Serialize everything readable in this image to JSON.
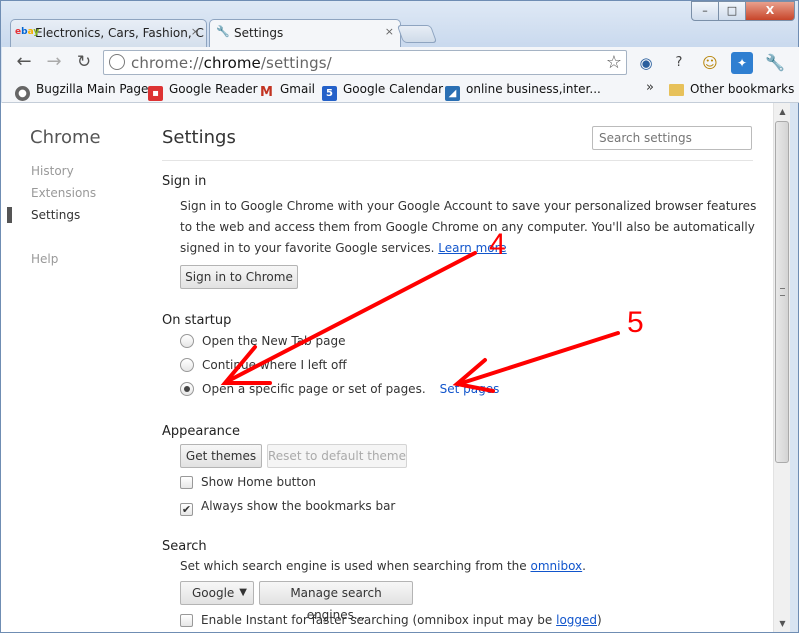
{
  "window": {
    "tabs": [
      {
        "label": "Electronics, Cars, Fashion, C",
        "icon": "ebay-icon",
        "close": "×"
      },
      {
        "label": "Settings",
        "icon": "wrench-icon",
        "close": "×"
      }
    ],
    "controls": {
      "minimize": "–",
      "maximize": "□",
      "close": "X"
    }
  },
  "toolbar": {
    "url_scheme": "chrome://",
    "url_host": "chrome",
    "url_path": "/settings/",
    "back_glyph": "←",
    "forward_glyph": "→",
    "reload_glyph": "C"
  },
  "bookmarks": {
    "items": [
      {
        "label": "Bugzilla Main Page",
        "icon": "bugzilla-icon"
      },
      {
        "label": "Google Reader",
        "icon": "google-reader-icon"
      },
      {
        "label": "Gmail",
        "icon": "gmail-icon",
        "glyph": "M"
      },
      {
        "label": "Google Calendar",
        "icon": "calendar-icon",
        "glyph": "5"
      },
      {
        "label": "online business,inter...",
        "icon": "bookmark-page-icon"
      }
    ],
    "more": "»",
    "other": "Other bookmarks"
  },
  "sidebar": {
    "title": "Chrome",
    "items": {
      "history": "History",
      "extensions": "Extensions",
      "settings": "Settings",
      "help": "Help"
    },
    "selected": "Settings"
  },
  "main": {
    "title": "Settings",
    "search_placeholder": "Search settings",
    "signin": {
      "heading": "Sign in",
      "text": "Sign in to Google Chrome with your Google Account to save your personalized browser features to the web and access them from Google Chrome on any computer. You'll also be automatically signed in to your favorite Google services.",
      "link": "Learn more",
      "button": "Sign in to Chrome"
    },
    "startup": {
      "heading": "On startup",
      "options": [
        {
          "label": "Open the New Tab page",
          "selected": false
        },
        {
          "label": "Continue where I left off",
          "selected": false
        },
        {
          "label": "Open a specific page or set of pages.",
          "selected": true
        }
      ],
      "set_pages": "Set pages"
    },
    "appearance": {
      "heading": "Appearance",
      "get_themes": "Get themes",
      "reset_theme": "Reset to default theme",
      "show_home": {
        "label": "Show Home button",
        "checked": false
      },
      "show_bookmarks": {
        "label": "Always show the bookmarks bar",
        "checked": true
      }
    },
    "search": {
      "heading": "Search",
      "text": "Set which search engine is used when searching from the",
      "link": "omnibox",
      "engine": "Google",
      "manage": "Manage search engines...",
      "instant_prefix": "Enable Instant for faster searching (omnibox input may be",
      "instant_link": "logged",
      "instant_suffix": ")"
    }
  },
  "annotations": {
    "label_1": "4",
    "label_2": "5",
    "color": "#ff0000"
  }
}
